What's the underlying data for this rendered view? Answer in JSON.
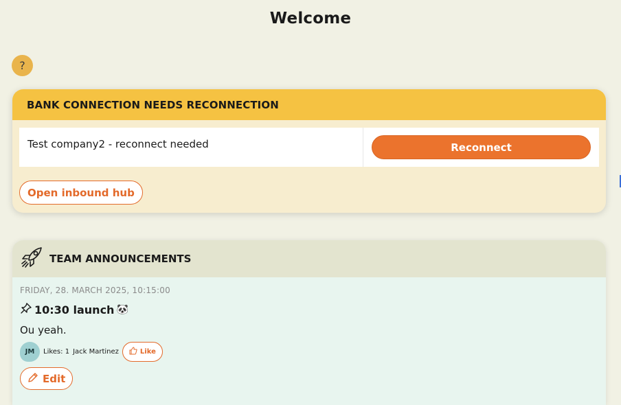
{
  "page": {
    "title": "Welcome",
    "help_label": "?"
  },
  "bank_card": {
    "header": "BANK CONNECTION NEEDS RECONNECTION",
    "row": {
      "message": "Test company2 - reconnect needed",
      "action_label": "Reconnect"
    },
    "open_hub_label": "Open inbound hub"
  },
  "announcements": {
    "header": "TEAM ANNOUNCEMENTS",
    "header_icon": "rocket-icon",
    "items": [
      {
        "date": "FRIDAY, 28. MARCH 2025, 10:15:00",
        "pin_icon": "pin-icon",
        "title": "10:30 launch",
        "title_emoji": "🐼",
        "body": "Ou yeah.",
        "avatar_initials": "JM",
        "likes_text": "Likes: 1",
        "liker": "Jack Martinez",
        "like_label": "Like",
        "edit_label": "Edit"
      }
    ]
  },
  "colors": {
    "background": "#f1f1e4",
    "warning_header": "#f5c242",
    "accent": "#eb732d",
    "announcement_bg": "#e8f5ef"
  }
}
